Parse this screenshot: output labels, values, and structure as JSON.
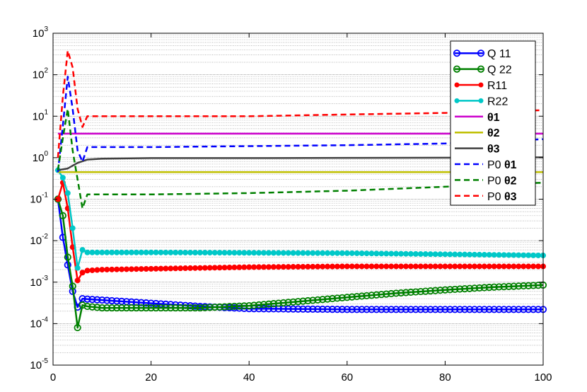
{
  "chart_data": {
    "type": "line",
    "title": "",
    "xlabel": "",
    "ylabel": "",
    "xlim": [
      0,
      100
    ],
    "ylim": [
      1e-05,
      1000
    ],
    "yscale": "log",
    "grid": "y-minor",
    "legend_position": "top-right",
    "x_ticks": [
      0,
      20,
      40,
      60,
      80,
      100
    ],
    "x_tick_labels": [
      "0",
      "20",
      "40",
      "60",
      "80",
      "100"
    ],
    "y_ticks": [
      1e-05,
      0.0001,
      0.001,
      0.01,
      0.1,
      1,
      10,
      100,
      1000
    ],
    "y_tick_labels": [
      {
        "base": "10",
        "exp": "-5"
      },
      {
        "base": "10",
        "exp": "-4"
      },
      {
        "base": "10",
        "exp": "-3"
      },
      {
        "base": "10",
        "exp": "-2"
      },
      {
        "base": "10",
        "exp": "-1"
      },
      {
        "base": "10",
        "exp": "0"
      },
      {
        "base": "10",
        "exp": "1"
      },
      {
        "base": "10",
        "exp": "2"
      },
      {
        "base": "10",
        "exp": "3"
      }
    ],
    "series": [
      {
        "name": "Q  11",
        "name_parts": [
          {
            "text": "Q  11",
            "bold": false
          }
        ],
        "color": "#0000ff",
        "dash": "solid",
        "marker": "circle",
        "x": [
          1,
          2,
          3,
          4,
          5,
          6,
          7,
          10,
          20,
          30,
          40,
          60,
          80,
          100
        ],
        "y": [
          0.1,
          0.012,
          0.0026,
          0.0006,
          0.00025,
          0.0004,
          0.00039,
          0.00037,
          0.00031,
          0.00026,
          0.00023,
          0.00022,
          0.00022,
          0.00022
        ]
      },
      {
        "name": "Q  22",
        "name_parts": [
          {
            "text": "Q  22",
            "bold": false
          }
        ],
        "color": "#008000",
        "dash": "solid",
        "marker": "circle",
        "x": [
          1,
          2,
          3,
          4,
          5,
          6,
          7,
          10,
          20,
          30,
          40,
          50,
          60,
          70,
          80,
          90,
          100
        ],
        "y": [
          0.1,
          0.04,
          0.004,
          0.0008,
          8e-05,
          0.00028,
          0.00026,
          0.00024,
          0.00024,
          0.00024,
          0.00027,
          0.00034,
          0.00043,
          0.00054,
          0.00065,
          0.00076,
          0.00085
        ]
      },
      {
        "name": "R11",
        "name_parts": [
          {
            "text": "R11",
            "bold": false
          }
        ],
        "color": "#ff0000",
        "dash": "solid",
        "marker": "dot",
        "x": [
          1,
          2,
          3,
          4,
          5,
          6,
          7,
          10,
          20,
          40,
          60,
          80,
          100
        ],
        "y": [
          0.1,
          0.25,
          0.06,
          0.007,
          0.0011,
          0.0017,
          0.0019,
          0.002,
          0.0021,
          0.0023,
          0.0024,
          0.0024,
          0.0024
        ]
      },
      {
        "name": "R22",
        "name_parts": [
          {
            "text": "R22",
            "bold": false
          }
        ],
        "color": "#00c8c8",
        "dash": "solid",
        "marker": "dot",
        "x": [
          1,
          2,
          3,
          4,
          5,
          6,
          7,
          10,
          20,
          40,
          60,
          80,
          100
        ],
        "y": [
          0.5,
          0.33,
          0.14,
          0.02,
          0.0022,
          0.006,
          0.0052,
          0.0052,
          0.0052,
          0.0051,
          0.005,
          0.0047,
          0.0044
        ]
      },
      {
        "name": "θ1",
        "name_parts": [
          {
            "text": "θ",
            "bold": true
          },
          {
            "text": "1",
            "bold": true
          }
        ],
        "color": "#cc00cc",
        "dash": "solid",
        "marker": "none",
        "x": [
          1,
          100
        ],
        "y": [
          3.8,
          3.8
        ]
      },
      {
        "name": "θ2",
        "name_parts": [
          {
            "text": "θ",
            "bold": true
          },
          {
            "text": "2",
            "bold": true
          }
        ],
        "color": "#bfbf00",
        "dash": "solid",
        "marker": "none",
        "x": [
          1,
          100
        ],
        "y": [
          0.45,
          0.45
        ]
      },
      {
        "name": "θ3",
        "name_parts": [
          {
            "text": "θ",
            "bold": true
          },
          {
            "text": "3",
            "bold": true
          }
        ],
        "color": "#404040",
        "dash": "solid",
        "marker": "none",
        "x": [
          1,
          3,
          5,
          7,
          10,
          20,
          40,
          60,
          80,
          100
        ],
        "y": [
          0.5,
          0.55,
          0.75,
          0.9,
          0.95,
          0.98,
          0.98,
          0.99,
          1.0,
          1.02
        ]
      },
      {
        "name": "P0 θ1",
        "name_parts": [
          {
            "text": "P0 ",
            "bold": false
          },
          {
            "text": "θ",
            "bold": true
          },
          {
            "text": "1",
            "bold": true
          }
        ],
        "color": "#0000ff",
        "dash": "dashed",
        "marker": "none",
        "x": [
          1,
          2,
          3,
          4,
          5,
          6,
          7,
          10,
          20,
          40,
          60,
          80,
          100
        ],
        "y": [
          0.45,
          6,
          90,
          15,
          1.5,
          0.8,
          1.8,
          1.8,
          1.8,
          1.9,
          2.0,
          2.2,
          2.8
        ]
      },
      {
        "name": "P0 θ2",
        "name_parts": [
          {
            "text": "P0 ",
            "bold": false
          },
          {
            "text": "θ",
            "bold": true
          },
          {
            "text": "2",
            "bold": true
          }
        ],
        "color": "#008000",
        "dash": "dashed",
        "marker": "none",
        "x": [
          1,
          2,
          3,
          4,
          5,
          6,
          7,
          10,
          20,
          40,
          60,
          80,
          100
        ],
        "y": [
          0.5,
          3,
          15,
          1.5,
          0.3,
          0.06,
          0.13,
          0.13,
          0.13,
          0.14,
          0.16,
          0.2,
          0.25
        ]
      },
      {
        "name": "P0 θ3",
        "name_parts": [
          {
            "text": "P0 ",
            "bold": false
          },
          {
            "text": "θ",
            "bold": true
          },
          {
            "text": "3",
            "bold": true
          }
        ],
        "color": "#ff0000",
        "dash": "dashed",
        "marker": "none",
        "x": [
          1,
          2,
          3,
          4,
          5,
          6,
          7,
          10,
          20,
          40,
          60,
          80,
          100
        ],
        "y": [
          1.0,
          30,
          380,
          150,
          15,
          5.5,
          10,
          10,
          10,
          10,
          11,
          12,
          14
        ]
      }
    ]
  }
}
